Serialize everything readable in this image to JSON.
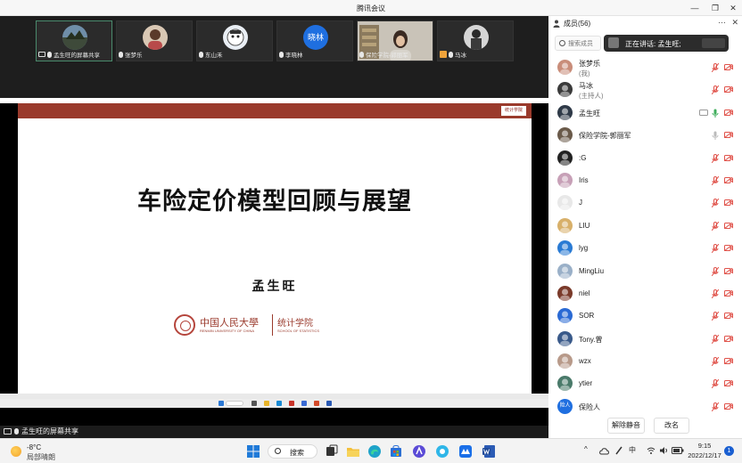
{
  "window": {
    "title": "腾讯会议"
  },
  "video_tiles": [
    {
      "name": "孟生旺的屏幕共享",
      "active": true
    },
    {
      "name": "张梦乐"
    },
    {
      "name": "东山禾"
    },
    {
      "name": "李晓林",
      "avatar_text": "晓林"
    },
    {
      "name": "保险学院-郭丽军"
    },
    {
      "name": "马冰"
    }
  ],
  "slide": {
    "title": "车险定价模型回顾与展望",
    "author": "孟生旺",
    "university_cn": "中国人民大學",
    "university_en": "RENMIN UNIVERSITY OF CHINA",
    "department_cn": "统计学院",
    "department_en": "SCHOOL OF STATISTICS",
    "logo_text": "统计学院"
  },
  "sharer_label": "孟生旺的屏幕共享",
  "panel": {
    "title": "成员(56)",
    "search_placeholder": "搜索成员",
    "speaking": "正在讲话: 孟生旺;",
    "members": [
      {
        "name": "张梦乐",
        "role": "(我)",
        "mic_on": false,
        "cam_on": false
      },
      {
        "name": "马冰",
        "role": "(主持人)",
        "mic_on": false,
        "cam_on": false
      },
      {
        "name": "孟生旺",
        "mic_on": true,
        "cam_on": false,
        "sharing": true
      },
      {
        "name": "保险学院-郭丽军",
        "mic_on": true,
        "mic_muted_grey": true,
        "cam_on": false
      },
      {
        "name": ":G",
        "mic_on": false,
        "cam_on": false
      },
      {
        "name": "Iris",
        "mic_on": false,
        "cam_on": false
      },
      {
        "name": "J",
        "mic_on": false,
        "cam_on": false
      },
      {
        "name": "LIU",
        "mic_on": false,
        "cam_on": false
      },
      {
        "name": "lyg",
        "mic_on": false,
        "cam_on": false
      },
      {
        "name": "MingLiu",
        "mic_on": false,
        "cam_on": false
      },
      {
        "name": "niel",
        "mic_on": false,
        "cam_on": false
      },
      {
        "name": "SOR",
        "mic_on": false,
        "cam_on": false
      },
      {
        "name": "Tony.曾",
        "mic_on": false,
        "cam_on": false
      },
      {
        "name": "wzx",
        "mic_on": false,
        "cam_on": false
      },
      {
        "name": "ytier",
        "mic_on": false,
        "cam_on": false
      },
      {
        "name": "保险人",
        "avatar_text": "险人",
        "mic_on": false,
        "cam_on": false
      }
    ],
    "unmute_all_label": "解除静音",
    "rename_label": "改名"
  },
  "taskbar": {
    "temperature": "-8°C",
    "weather": "局部晴朗",
    "search_label": "搜索",
    "ime": "中",
    "time": "9:15",
    "date": "2022/12/17",
    "notification_count": "1"
  },
  "colors": {
    "accent_green": "#4a8a6c",
    "slide_red": "#9a3a2c",
    "muted_red": "#e0524a",
    "mic_green": "#3fae5c"
  }
}
